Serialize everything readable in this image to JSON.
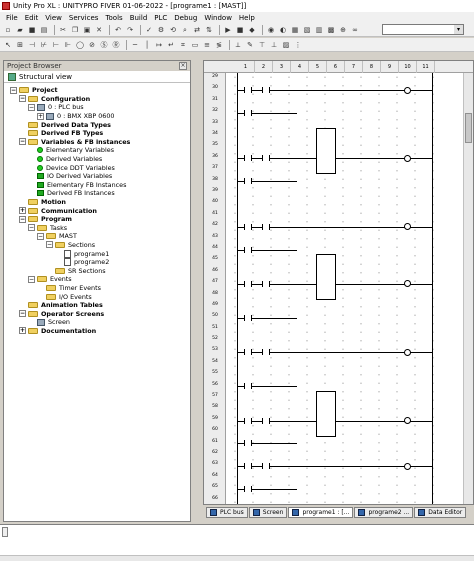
{
  "window": {
    "title": "Unity Pro XL : UNITYPRO FIVER 01-06-2022 - [programe1 : [MAST]]"
  },
  "menu": [
    "File",
    "Edit",
    "View",
    "Services",
    "Tools",
    "Build",
    "PLC",
    "Debug",
    "Window",
    "Help"
  ],
  "browser": {
    "title": "Project Browser",
    "close_label": "×",
    "view_label": "Structural view",
    "tree": [
      {
        "label": "Project",
        "depth": 0,
        "bold": true,
        "icon": "folder",
        "toggle": "-"
      },
      {
        "label": "Configuration",
        "depth": 1,
        "bold": true,
        "icon": "folder",
        "toggle": "-"
      },
      {
        "label": "0 : PLC bus",
        "depth": 2,
        "bold": false,
        "icon": "mini",
        "toggle": "-"
      },
      {
        "label": "0 : BMX XBP 0600",
        "depth": 3,
        "bold": false,
        "icon": "mini",
        "toggle": "+"
      },
      {
        "label": "Derived Data Types",
        "depth": 1,
        "bold": true,
        "icon": "folder",
        "toggle": ""
      },
      {
        "label": "Derived FB Types",
        "depth": 1,
        "bold": true,
        "icon": "folder",
        "toggle": ""
      },
      {
        "label": "Variables & FB instances",
        "depth": 1,
        "bold": true,
        "icon": "folder",
        "toggle": "-"
      },
      {
        "label": "Elementary Variables",
        "depth": 2,
        "bold": false,
        "icon": "dot",
        "toggle": ""
      },
      {
        "label": "Derived Variables",
        "depth": 2,
        "bold": false,
        "icon": "dot",
        "toggle": ""
      },
      {
        "label": "Device DDT Variables",
        "depth": 2,
        "bold": false,
        "icon": "dot",
        "toggle": ""
      },
      {
        "label": "IO Derived Variables",
        "depth": 2,
        "bold": false,
        "icon": "sq",
        "toggle": ""
      },
      {
        "label": "Elementary FB Instances",
        "depth": 2,
        "bold": false,
        "icon": "sq",
        "toggle": ""
      },
      {
        "label": "Derived FB Instances",
        "depth": 2,
        "bold": false,
        "icon": "sq",
        "toggle": ""
      },
      {
        "label": "Motion",
        "depth": 1,
        "bold": true,
        "icon": "folder",
        "toggle": ""
      },
      {
        "label": "Communication",
        "depth": 1,
        "bold": true,
        "icon": "folder",
        "toggle": "+"
      },
      {
        "label": "Program",
        "depth": 1,
        "bold": true,
        "icon": "folder",
        "toggle": "-"
      },
      {
        "label": "Tasks",
        "depth": 2,
        "bold": false,
        "icon": "folder",
        "toggle": "-"
      },
      {
        "label": "MAST",
        "depth": 3,
        "bold": false,
        "icon": "folder",
        "toggle": "-"
      },
      {
        "label": "Sections",
        "depth": 4,
        "bold": false,
        "icon": "folder",
        "toggle": "-"
      },
      {
        "label": "programe1",
        "depth": 5,
        "bold": false,
        "icon": "page",
        "toggle": ""
      },
      {
        "label": "programe2",
        "depth": 5,
        "bold": false,
        "icon": "page",
        "toggle": ""
      },
      {
        "label": "SR Sections",
        "depth": 4,
        "bold": false,
        "icon": "folder",
        "toggle": ""
      },
      {
        "label": "Events",
        "depth": 2,
        "bold": false,
        "icon": "folder",
        "toggle": "-"
      },
      {
        "label": "Timer Events",
        "depth": 3,
        "bold": false,
        "icon": "folder",
        "toggle": ""
      },
      {
        "label": "I/O Events",
        "depth": 3,
        "bold": false,
        "icon": "folder",
        "toggle": ""
      },
      {
        "label": "Animation Tables",
        "depth": 1,
        "bold": true,
        "icon": "folder",
        "toggle": ""
      },
      {
        "label": "Operator Screens",
        "depth": 1,
        "bold": true,
        "icon": "folder",
        "toggle": "-"
      },
      {
        "label": "Screen",
        "depth": 2,
        "bold": false,
        "icon": "mini",
        "toggle": ""
      },
      {
        "label": "Documentation",
        "depth": 1,
        "bold": true,
        "icon": "folder",
        "toggle": "+"
      }
    ]
  },
  "editor": {
    "columns": [
      "1",
      "2",
      "3",
      "4",
      "5",
      "6",
      "7",
      "8",
      "9",
      "10",
      "11"
    ],
    "rows": [
      "29",
      "30",
      "31",
      "32",
      "33",
      "34",
      "35",
      "36",
      "37",
      "38",
      "39",
      "40",
      "41",
      "42",
      "43",
      "44",
      "45",
      "46",
      "47",
      "48",
      "49",
      "50",
      "51",
      "52",
      "53",
      "54",
      "55",
      "56",
      "57",
      "58",
      "59",
      "60",
      "61",
      "62",
      "63",
      "64",
      "65",
      "66"
    ]
  },
  "tabs": [
    {
      "label": "PLC bus",
      "active": false
    },
    {
      "label": "Screen",
      "active": false
    },
    {
      "label": "programe1 : [...",
      "active": true
    },
    {
      "label": "programe2 ...",
      "active": false
    },
    {
      "label": "Data Editor",
      "active": false
    }
  ]
}
